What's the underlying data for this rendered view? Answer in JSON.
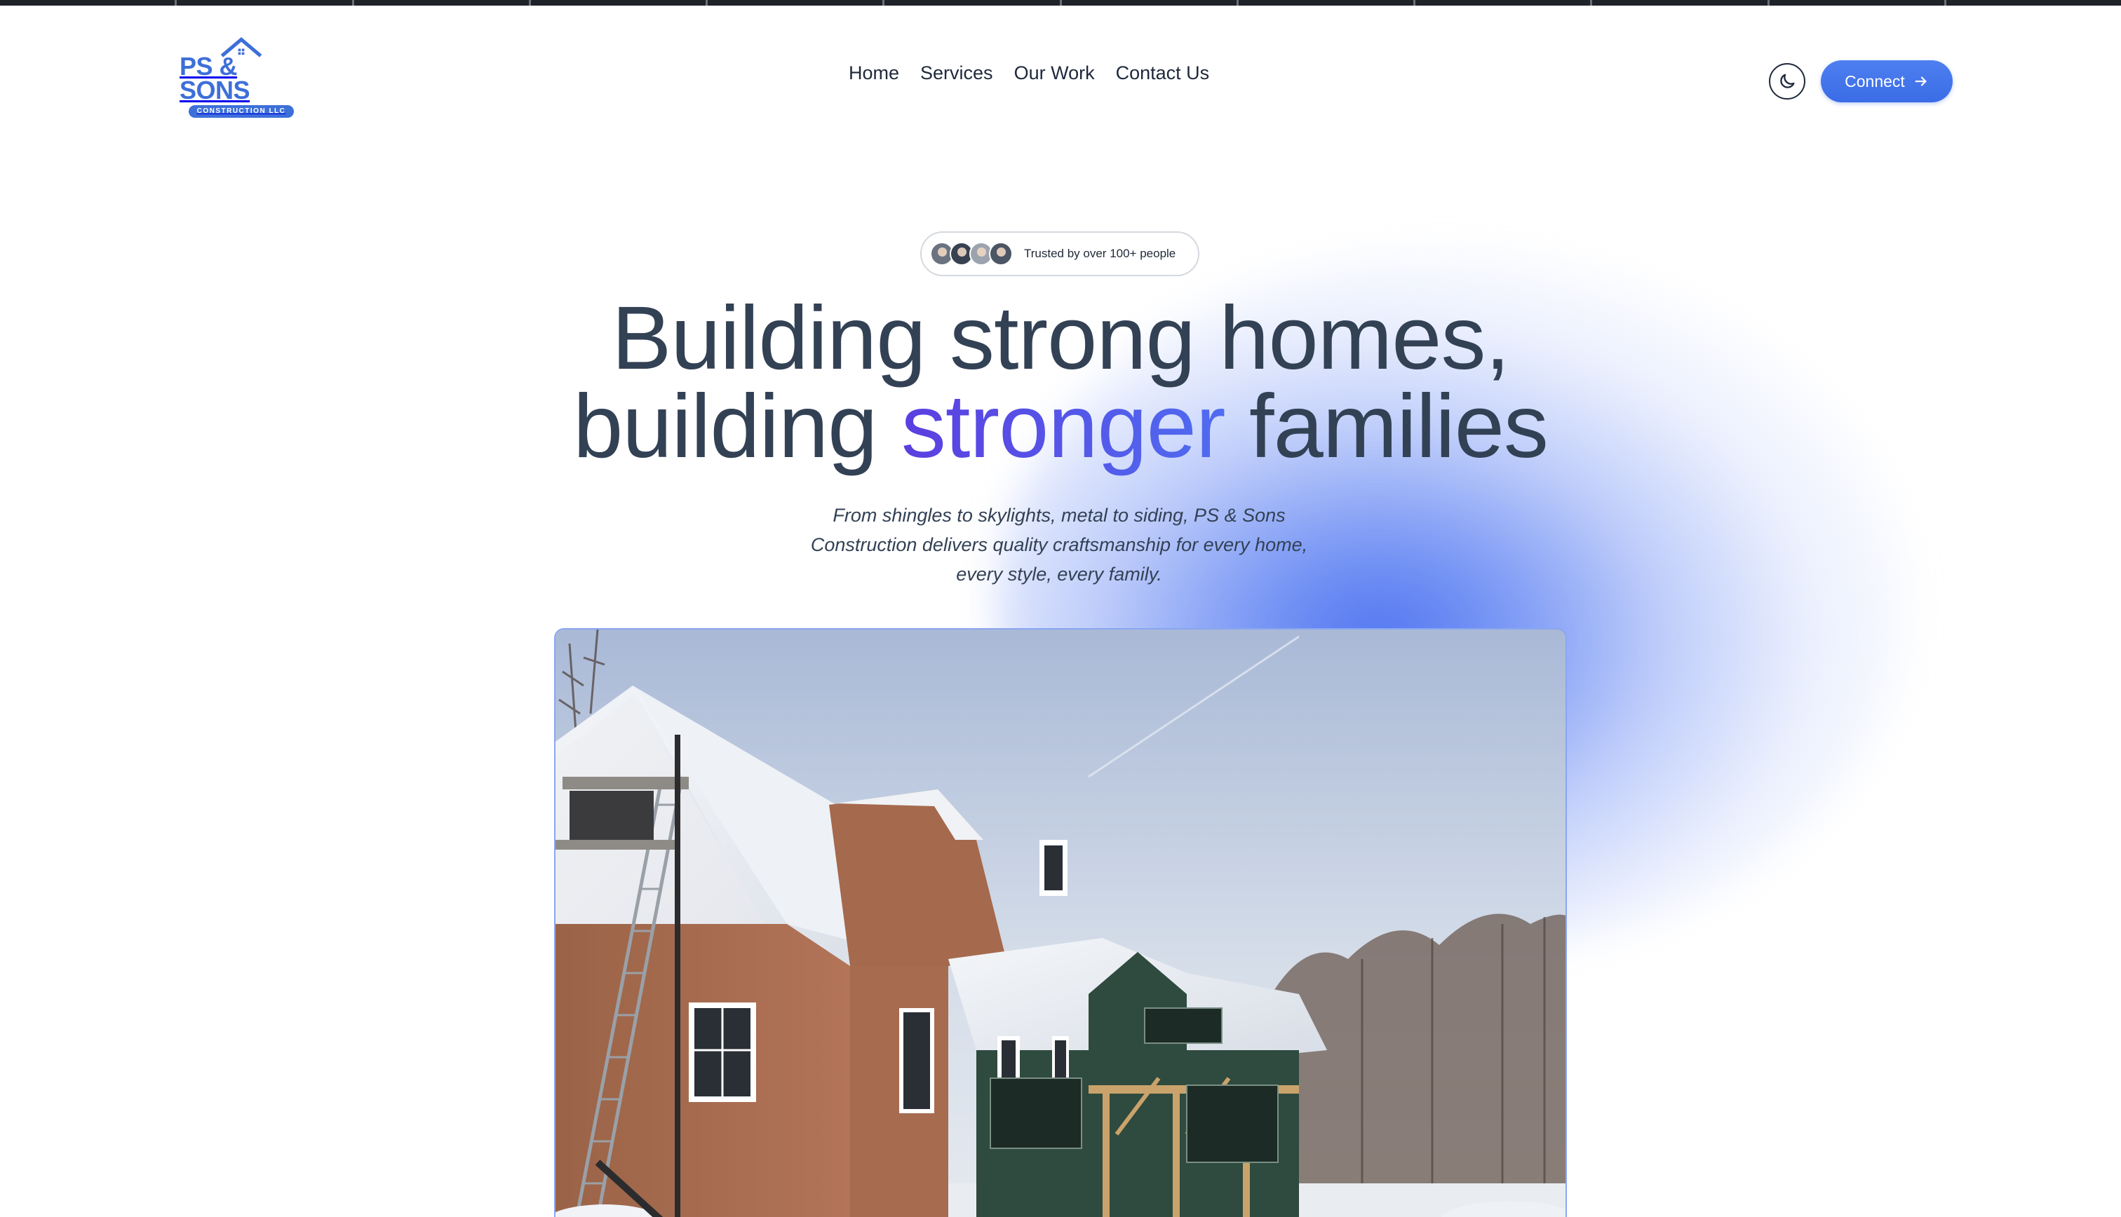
{
  "header": {
    "logo": {
      "name": "PS & SONS",
      "tagline": "CONSTRUCTION LLC",
      "icon": "house-roof-icon",
      "brand_color": "#3d6fd9"
    },
    "nav": [
      {
        "label": "Home"
      },
      {
        "label": "Services"
      },
      {
        "label": "Our Work"
      },
      {
        "label": "Contact Us"
      }
    ],
    "theme_toggle": {
      "icon": "moon-icon"
    },
    "connect_button": {
      "label": "Connect",
      "icon": "arrow-right-icon",
      "color": "#3f6fe8"
    }
  },
  "hero": {
    "badge": {
      "text": "Trusted by over 100+ people",
      "avatar_count": 4
    },
    "headline": {
      "line1": "Building strong homes,",
      "line2_before": "building ",
      "line2_accent": "stronger",
      "line2_after": " families",
      "accent_color": "#5b3fe0"
    },
    "subtext": "From shingles to skylights, metal to siding, PS & Sons Construction delivers quality craftsmanship for every home, every style, every family.",
    "image": {
      "subject": "house-under-construction-photo"
    }
  }
}
